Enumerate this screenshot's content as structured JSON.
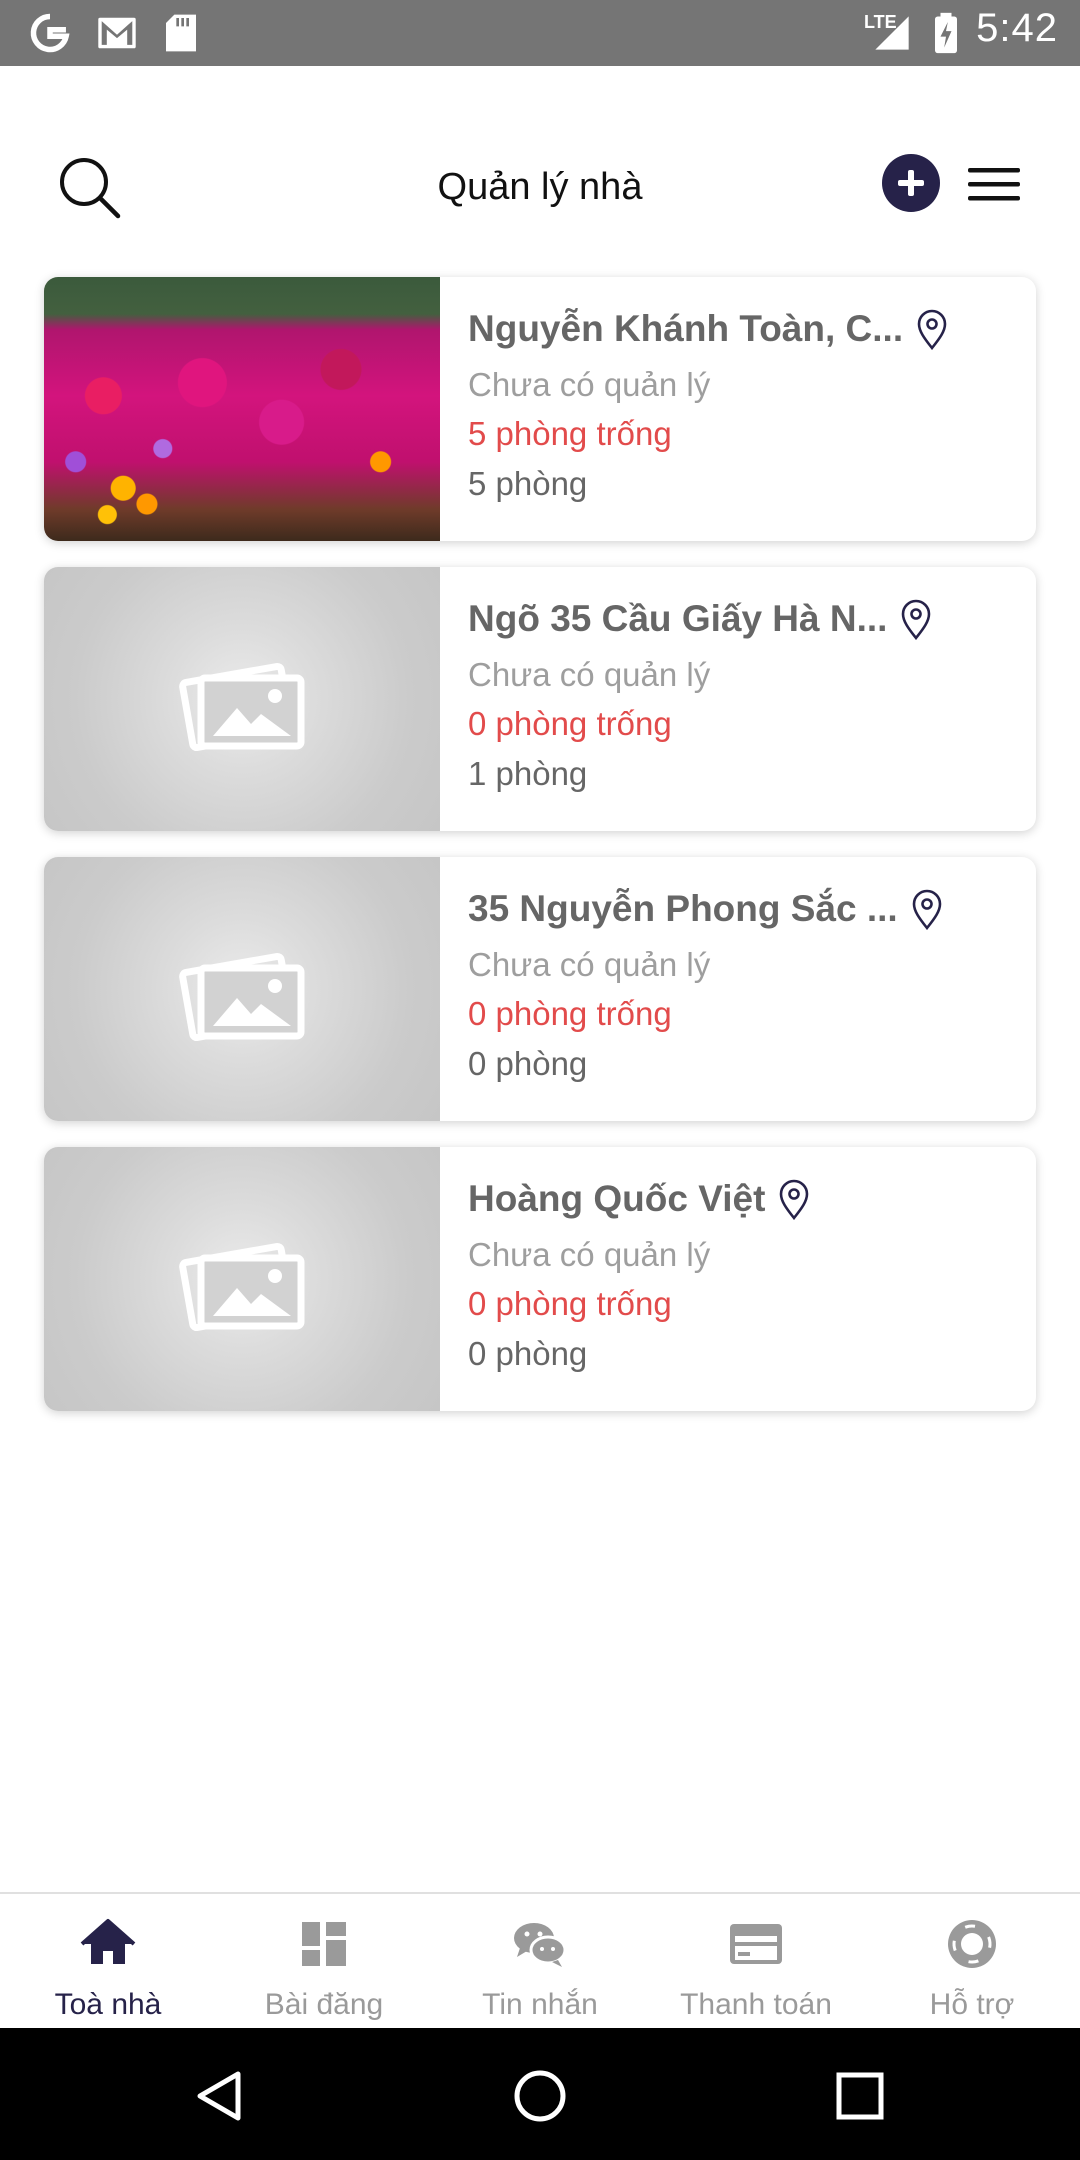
{
  "status_bar": {
    "time": "5:42",
    "network": "LTE",
    "icons": [
      "google-icon",
      "gmail-icon",
      "sd-card-icon",
      "signal-icon",
      "battery-charging-icon"
    ]
  },
  "header": {
    "title": "Quản lý nhà",
    "accent": "#262249"
  },
  "buildings": [
    {
      "name": "Nguyễn Khánh Toàn, C...",
      "manager": "Chưa có quản lý",
      "empty_rooms": "5 phòng trống",
      "rooms": "5 phòng",
      "image": "flowers-photo"
    },
    {
      "name": "Ngõ 35 Cầu Giấy Hà N...",
      "manager": "Chưa có quản lý",
      "empty_rooms": "0 phòng trống",
      "rooms": "1 phòng",
      "image": "placeholder-image-icon"
    },
    {
      "name": "35 Nguyễn Phong Sắc ...",
      "manager": "Chưa có quản lý",
      "empty_rooms": "0 phòng trống",
      "rooms": "0 phòng",
      "image": "placeholder-image-icon"
    },
    {
      "name": "Hoàng Quốc Việt",
      "manager": "Chưa có quản lý",
      "empty_rooms": "0 phòng trống",
      "rooms": "0 phòng",
      "image": "placeholder-image-icon"
    }
  ],
  "bottom_nav": {
    "items": [
      {
        "label": "Toà nhà",
        "icon": "home-icon",
        "active": true
      },
      {
        "label": "Bài đăng",
        "icon": "dashboard-icon",
        "active": false
      },
      {
        "label": "Tin nhắn",
        "icon": "chat-icon",
        "active": false
      },
      {
        "label": "Thanh toán",
        "icon": "credit-card-icon",
        "active": false
      },
      {
        "label": "Hỗ trợ",
        "icon": "lifebuoy-icon",
        "active": false
      }
    ]
  },
  "colors": {
    "empty_rooms_text": "#e24b4b",
    "active_nav": "#262249",
    "inactive_nav": "#9a9a9a"
  }
}
